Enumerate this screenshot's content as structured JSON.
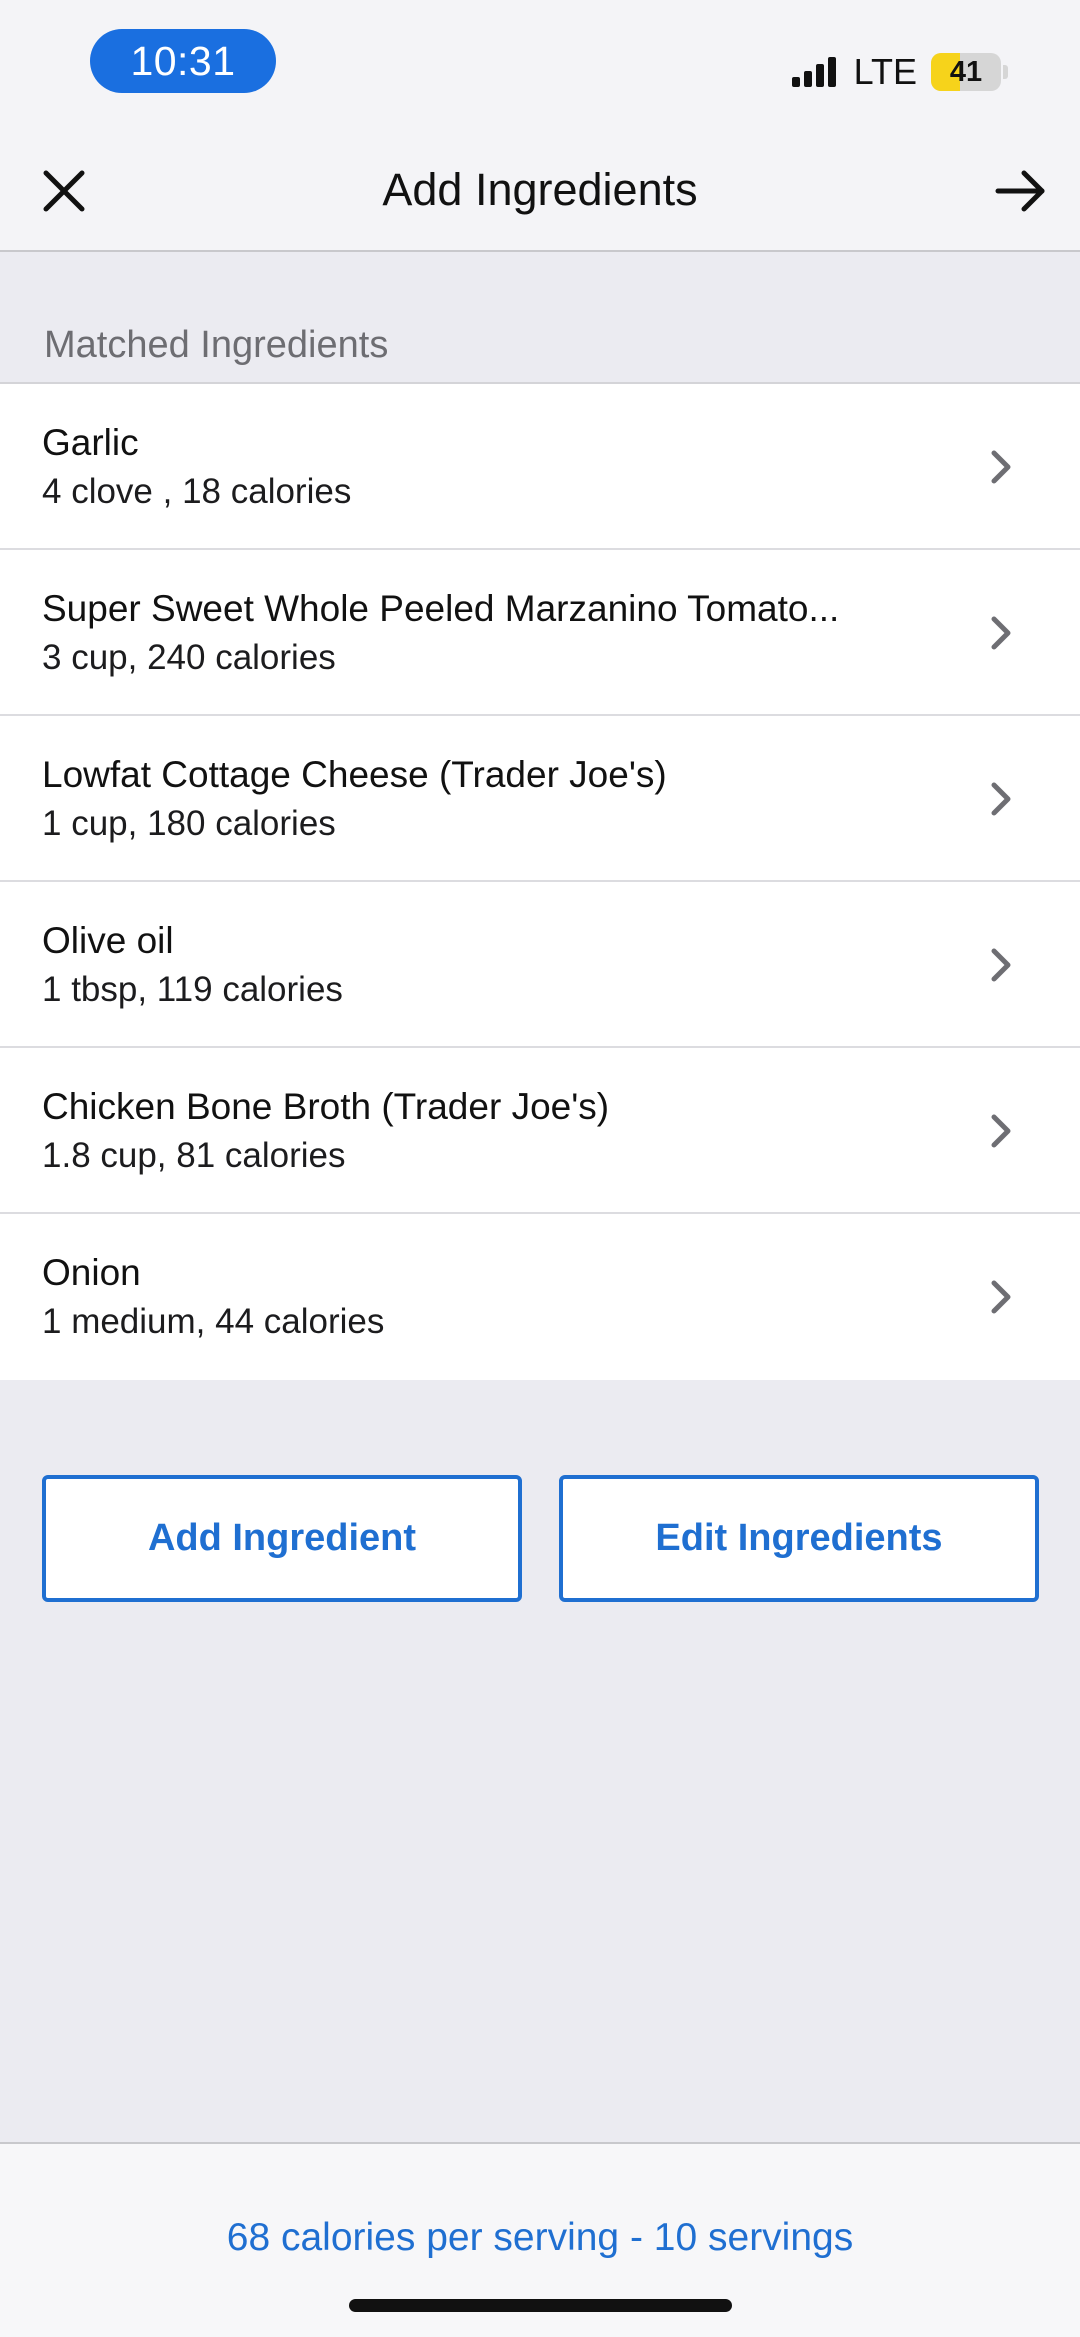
{
  "status_bar": {
    "time": "10:31",
    "network": "LTE",
    "battery_level": "41",
    "battery_fraction": 0.41,
    "colors": {
      "time_pill": "#1a6fe0",
      "battery": "#f6d31b"
    }
  },
  "nav": {
    "title": "Add Ingredients",
    "close_icon": "close-icon",
    "next_icon": "arrow-right-icon"
  },
  "section": {
    "title": "Matched Ingredients"
  },
  "ingredients": [
    {
      "name": "Garlic",
      "detail": "4 clove , 18 calories"
    },
    {
      "name": "Super Sweet Whole Peeled Marzanino Tomato...",
      "detail": "3 cup, 240 calories"
    },
    {
      "name": "Lowfat Cottage Cheese (Trader Joe's)",
      "detail": "1 cup, 180 calories"
    },
    {
      "name": "Olive oil",
      "detail": "1 tbsp, 119 calories"
    },
    {
      "name": "Chicken Bone Broth (Trader Joe's)",
      "detail": "1.8 cup, 81 calories"
    },
    {
      "name": "Onion",
      "detail": "1 medium, 44 calories"
    }
  ],
  "buttons": {
    "add_label": "Add Ingredient",
    "edit_label": "Edit Ingredients"
  },
  "footer": {
    "summary": "68 calories per serving - 10 servings"
  },
  "theme": {
    "accent": "#1f6fd1",
    "background": "#ebebf1"
  }
}
